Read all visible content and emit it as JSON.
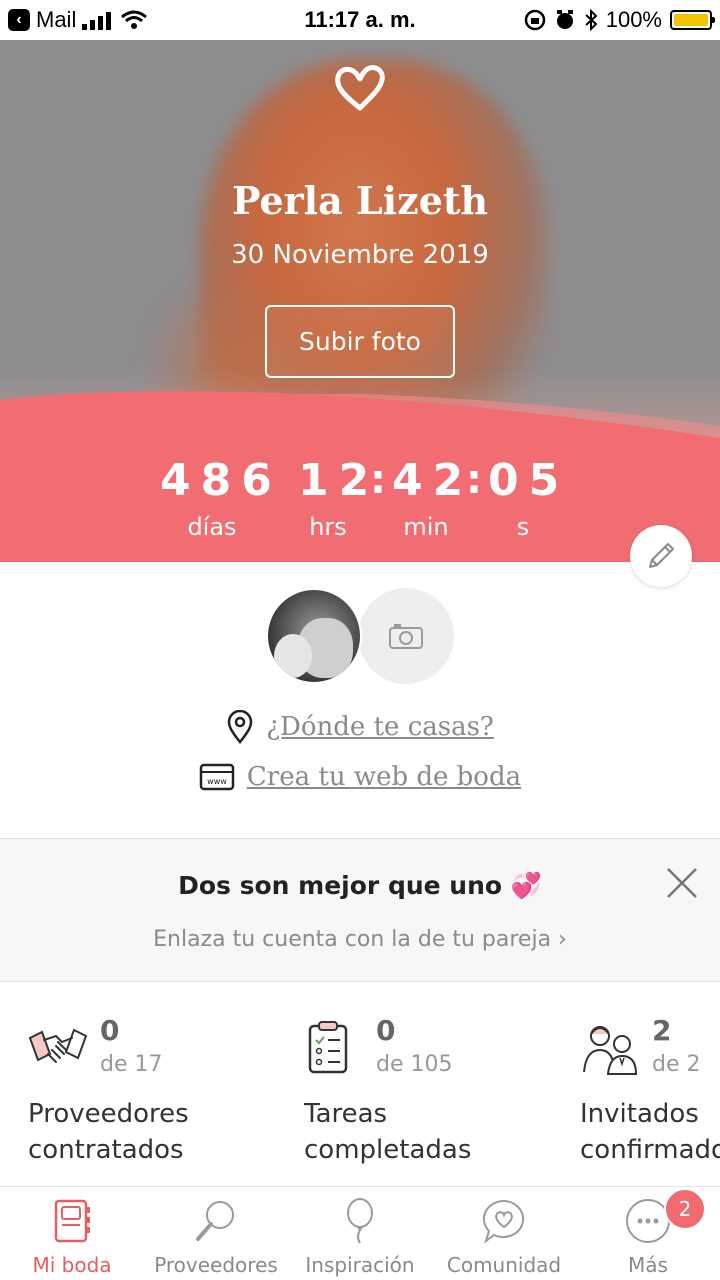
{
  "status_bar": {
    "back_app": "Mail",
    "time": "11:17 a. m.",
    "battery": "100%"
  },
  "hero": {
    "name": "Perla Lizeth",
    "date": "30 Noviembre 2019",
    "upload_button": "Subir foto",
    "countdown": {
      "days": "486",
      "days_label": "días",
      "hours": "12",
      "hours_label": "hrs",
      "minutes": "42",
      "minutes_label": "min",
      "seconds": "05",
      "seconds_label": "s"
    }
  },
  "profile": {
    "where_link": "¿Dónde te casas?",
    "web_link": "Crea tu web de boda"
  },
  "partner_card": {
    "title": "Dos son mejor que uno 💞",
    "subtitle": "Enlaza tu cuenta con la de tu pareja  ›"
  },
  "stats": [
    {
      "count": "0",
      "total": "de 17",
      "label_line1": "Proveedores",
      "label_line2": "contratados",
      "icon": "handshake-icon"
    },
    {
      "count": "0",
      "total": "de 105",
      "label_line1": "Tareas",
      "label_line2": "completadas",
      "icon": "checklist-icon"
    },
    {
      "count": "2",
      "total": "de 2",
      "label_line1": "Invitados",
      "label_line2": "confirmados",
      "icon": "guests-icon"
    }
  ],
  "tabs": [
    {
      "label": "Mi boda",
      "icon": "notebook-icon",
      "active": true
    },
    {
      "label": "Proveedores",
      "icon": "magnifier-icon",
      "active": false
    },
    {
      "label": "Inspiración",
      "icon": "balloon-icon",
      "active": false
    },
    {
      "label": "Comunidad",
      "icon": "chat-heart-icon",
      "active": false
    },
    {
      "label": "Más",
      "icon": "more-icon",
      "active": false
    }
  ],
  "more_badge": "2",
  "colors": {
    "accent": "#f26d72",
    "tab_active": "#e85c63",
    "battery": "#f5c400"
  }
}
